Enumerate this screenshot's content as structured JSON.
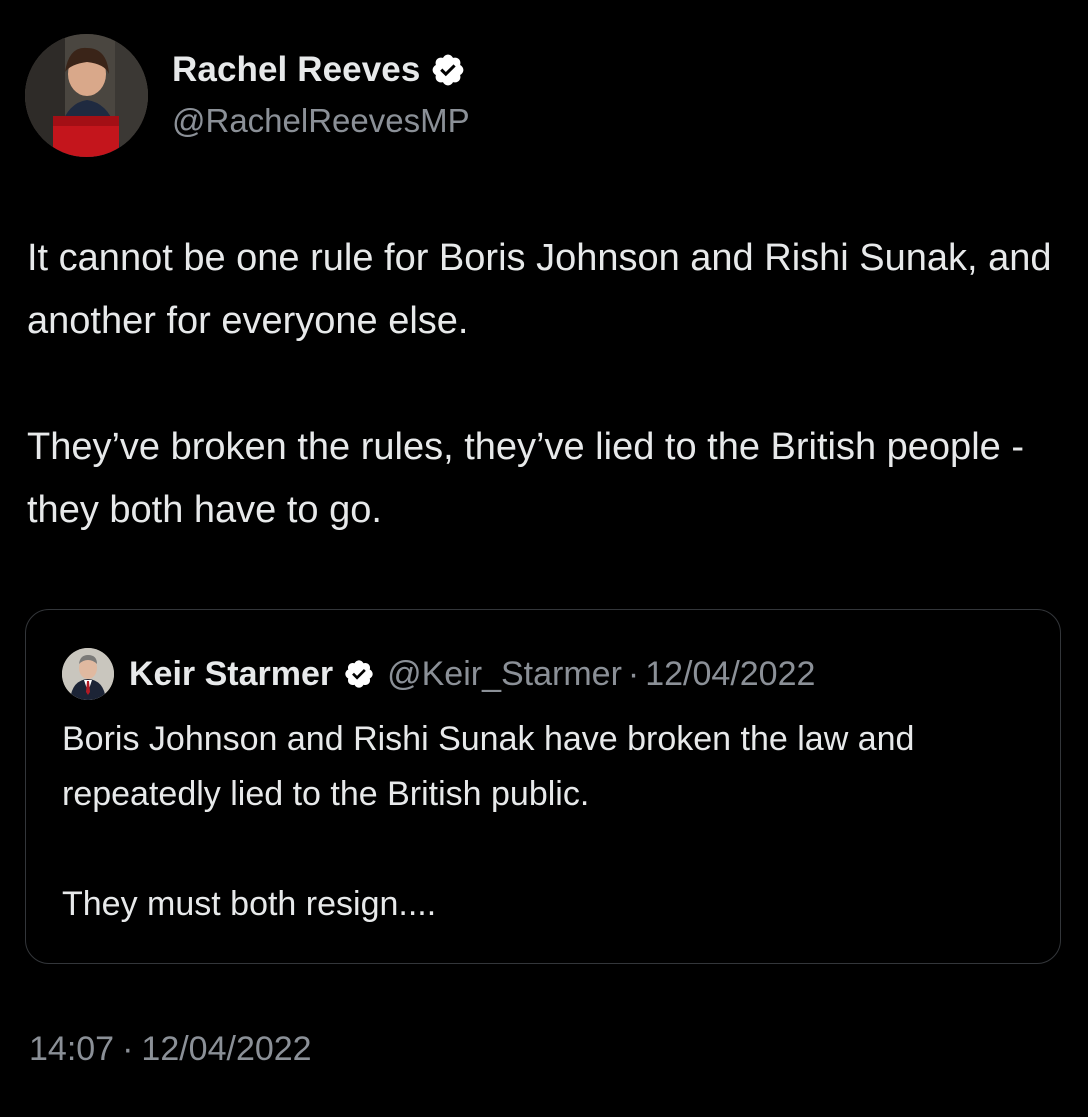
{
  "author": {
    "display_name": "Rachel Reeves",
    "handle": "@RachelReevesMP",
    "avatar_icon": "profile-photo-avatar",
    "verified_icon": "verified-badge-icon"
  },
  "tweet": {
    "paragraphs": [
      "It cannot be one rule for Boris Johnson and Rishi Sunak, and another for everyone else.",
      "They’ve broken the rules, they’ve lied to the British people - they both have to go."
    ]
  },
  "quoted_tweet": {
    "display_name": "Keir Starmer",
    "handle": "@Keir_Starmer",
    "separator": "·",
    "date": "12/04/2022",
    "paragraphs": [
      "Boris Johnson and Rishi Sunak have broken the law and repeatedly lied to the British public.",
      "They must both resign...."
    ]
  },
  "footer": {
    "time": "14:07",
    "separator": "·",
    "date": "12/04/2022"
  },
  "colors": {
    "background": "#000000",
    "text_primary": "#e7e9ea",
    "text_secondary": "#8b9097",
    "border": "#33363a",
    "verified_badge": "#ffffff"
  }
}
